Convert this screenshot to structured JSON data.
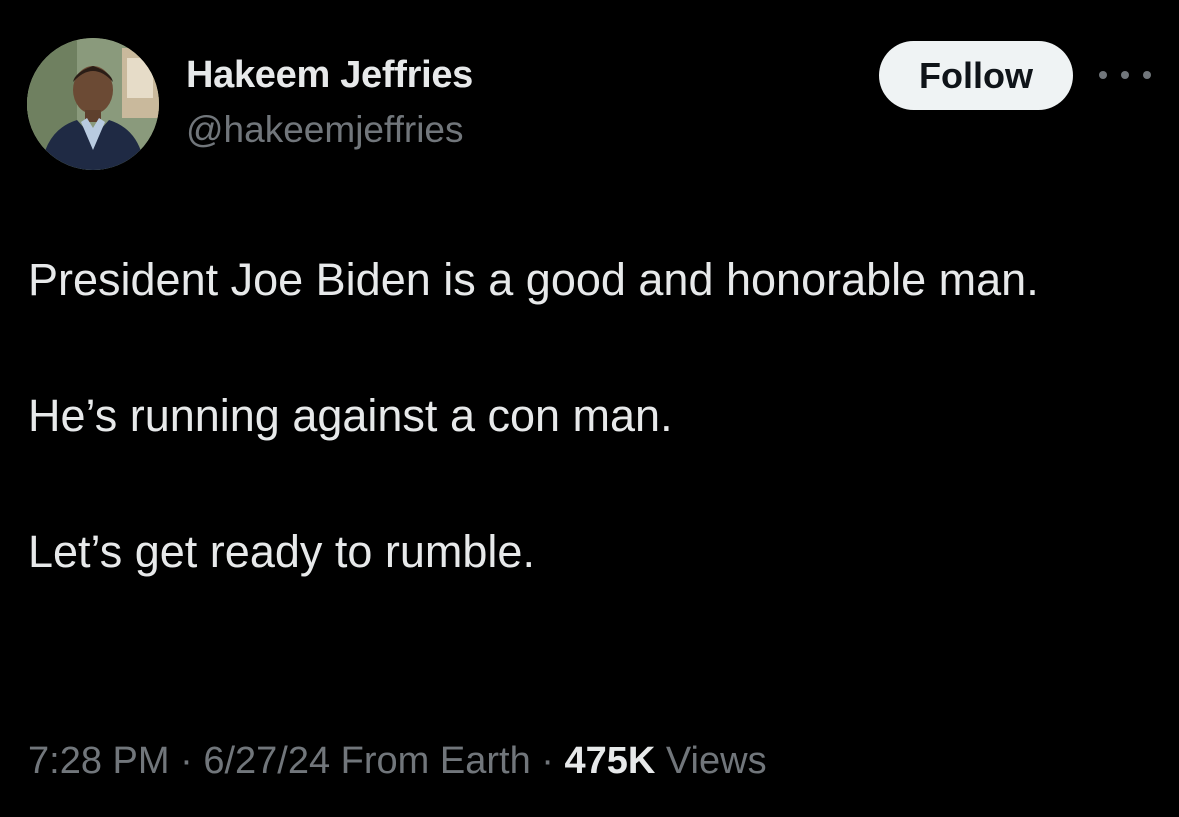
{
  "author": {
    "display_name": "Hakeem Jeffries",
    "handle": "@hakeemjeffries"
  },
  "actions": {
    "follow_label": "Follow",
    "more_icon": "ellipsis-horizontal-icon"
  },
  "tweet": {
    "paragraphs": [
      "President Joe Biden is a good and honorable man.",
      "He’s running against a con man.",
      "Let’s get ready to rumble."
    ]
  },
  "meta": {
    "time": "7:28 PM",
    "separator_1": " · ",
    "date": "6/27/24",
    "location": " From Earth",
    "separator_2": " · ",
    "views_count": "475K",
    "views_label": " Views"
  },
  "colors": {
    "background": "#000000",
    "primary_text": "#e7e9ea",
    "secondary_text": "#71767b",
    "follow_button_bg": "#eff3f4",
    "follow_button_text": "#0f1419"
  }
}
